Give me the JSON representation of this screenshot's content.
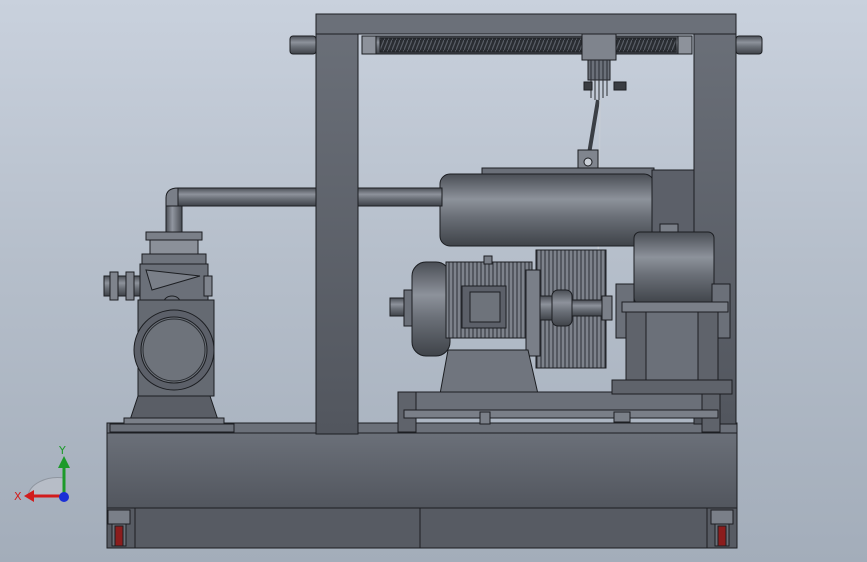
{
  "view": {
    "background_top": "#c9d1dd",
    "background_bottom": "#a3adba",
    "body_color": "#5c6069",
    "edge_color": "#1c1e22"
  },
  "triad": {
    "x_label": "X",
    "y_label": "Y",
    "x_color": "#d21c1c",
    "y_color": "#1c9a2a",
    "z_color": "#1a2fd6"
  },
  "parts": [
    "skid-base",
    "casters",
    "gantry-frame",
    "lead-screw",
    "screw-carriage",
    "suction-pipe",
    "transfer-pipe",
    "pump",
    "electric-motor",
    "shaft-coupling",
    "gearbox",
    "motor-base-frame",
    "cable-drum"
  ]
}
